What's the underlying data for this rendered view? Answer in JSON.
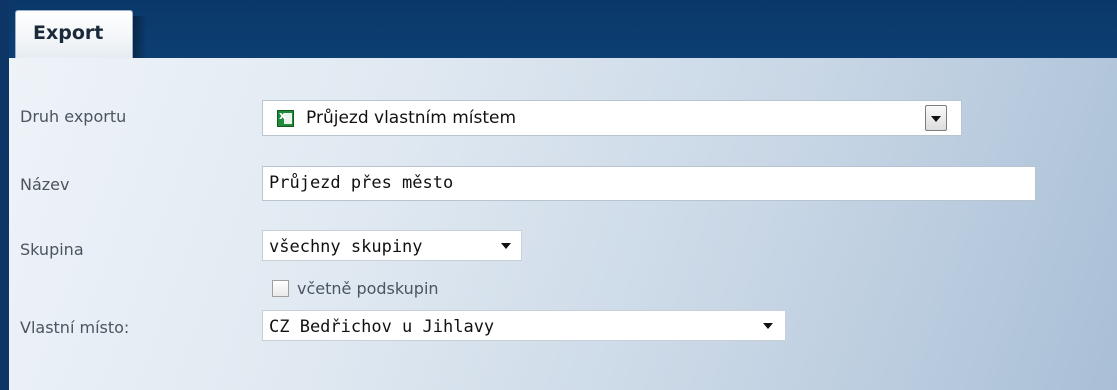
{
  "tabs": [
    {
      "label": "Export",
      "active": true
    }
  ],
  "form": {
    "druh_exportu": {
      "label": "Druh exportu",
      "value": "Průjezd vlastním místem",
      "icon": "excel-icon"
    },
    "nazev": {
      "label": "Název",
      "value": "Průjezd přes město"
    },
    "skupina": {
      "label": "Skupina",
      "value": "všechny skupiny"
    },
    "vcetne_podskupin": {
      "label": "včetně podskupin",
      "checked": false
    },
    "vlastni_misto": {
      "label": "Vlastní místo:",
      "value": "CZ Bedřichov u Jihlavy"
    }
  },
  "colors": {
    "header_bg": "#0a3768",
    "panel_gradient_start": "#eef3f8",
    "panel_gradient_end": "#a9bfd6",
    "label_text": "#4a5560"
  }
}
